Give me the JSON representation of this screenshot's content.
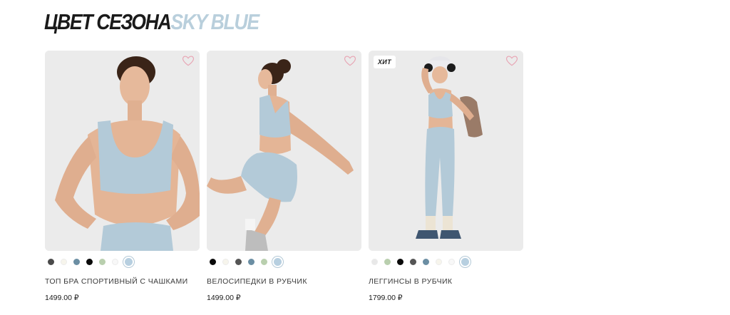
{
  "section": {
    "title_main": "ЦВЕТ СЕЗОНА",
    "title_accent": "SKY BLUE"
  },
  "products": [
    {
      "name": "ТОП БРА СПОРТИВНЫЙ С ЧАШКАМИ",
      "price": "1499.00 ₽",
      "badge": "",
      "swatches": [
        "#4a4a4a",
        "#f7f5ec",
        "#6b8ea3",
        "#0a0a0a",
        "#b9cfae",
        "#f8f8f8",
        "#b7cfe0"
      ],
      "selected_swatch": 6
    },
    {
      "name": "ВЕЛОСИПЕДКИ В РУБЧИК",
      "price": "1499.00 ₽",
      "badge": "",
      "swatches": [
        "#0a0a0a",
        "#f7f5ec",
        "#555555",
        "#6b8ea3",
        "#b9cfae",
        "#b7cfe0"
      ],
      "selected_swatch": 5
    },
    {
      "name": "ЛЕГГИНСЫ В РУБЧИК",
      "price": "1799.00 ₽",
      "badge": "ХИТ",
      "swatches": [
        "#e8e8e8",
        "#b9cfae",
        "#0a0a0a",
        "#555555",
        "#6b8ea3",
        "#f7f5ec",
        "#f8f8f8",
        "#b7cfe0"
      ],
      "selected_swatch": 7
    }
  ],
  "icons": {
    "favorite": "heart-outline-icon"
  },
  "colors": {
    "accent": "#b9cfdc",
    "heart": "#e8a5b4",
    "garment": "#b3cad8"
  }
}
